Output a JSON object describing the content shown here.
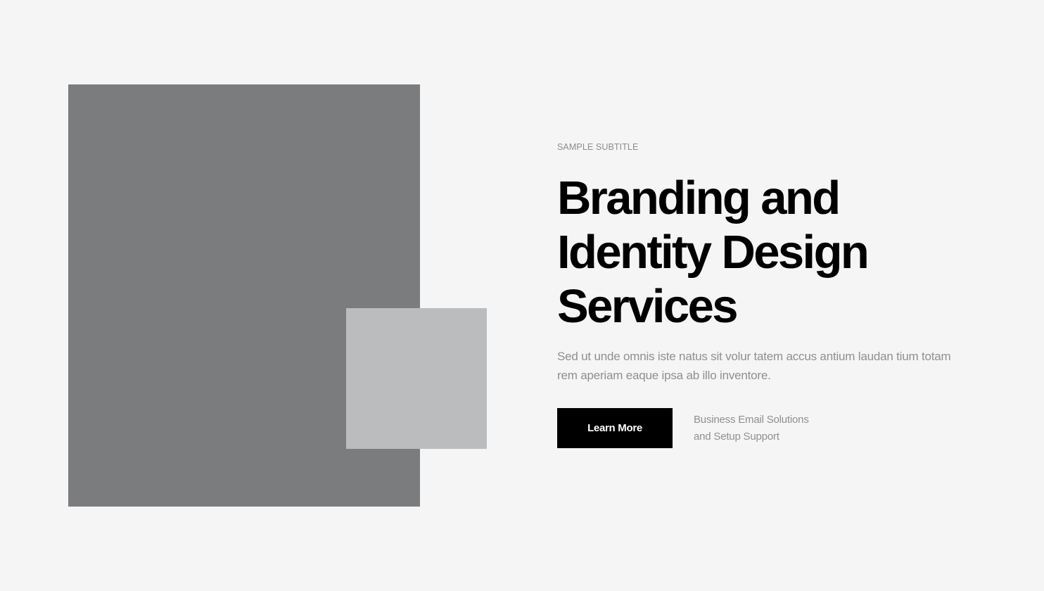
{
  "hero": {
    "subtitle": "SAMPLE SUBTITLE",
    "title_lines": [
      "Branding and",
      "Identity Design",
      "Services"
    ],
    "description": "Sed ut unde omnis iste natus sit volur tatem accus antium laudan tium totam rem aperiam eaque ipsa ab illo inventore.",
    "button_label": "Learn More",
    "note_lines": [
      "Business Email Solutions",
      "and Setup Support"
    ]
  },
  "colors": {
    "background": "#f5f5f5",
    "image_main": "#7b7c7e",
    "image_small": "#bbbcbe",
    "button": "#000000"
  }
}
